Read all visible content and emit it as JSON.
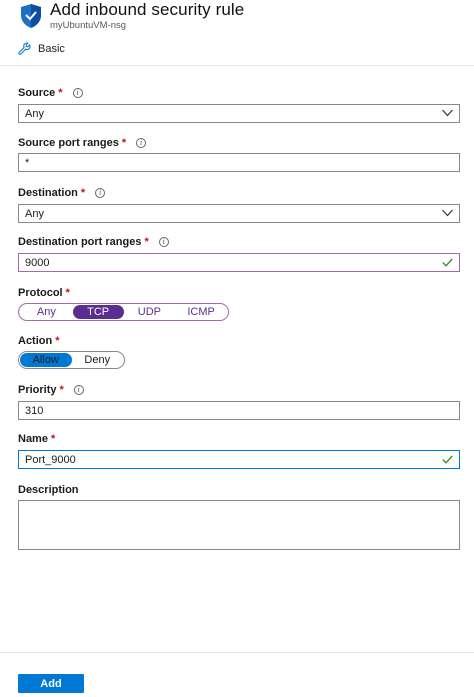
{
  "header": {
    "title": "Add inbound security rule",
    "subtitle": "myUbuntuVM-nsg",
    "mode_label": "Basic"
  },
  "form": {
    "source": {
      "label": "Source",
      "required": "*",
      "value": "Any"
    },
    "source_port_ranges": {
      "label": "Source port ranges",
      "required": "*",
      "value": "*"
    },
    "destination": {
      "label": "Destination",
      "required": "*",
      "value": "Any"
    },
    "destination_port_ranges": {
      "label": "Destination port ranges",
      "required": "*",
      "value": "9000"
    },
    "protocol": {
      "label": "Protocol",
      "required": "*",
      "options": [
        "Any",
        "TCP",
        "UDP",
        "ICMP"
      ],
      "selected": "TCP"
    },
    "action": {
      "label": "Action",
      "required": "*",
      "options": [
        "Allow",
        "Deny"
      ],
      "selected": "Allow"
    },
    "priority": {
      "label": "Priority",
      "required": "*",
      "value": "310"
    },
    "name": {
      "label": "Name",
      "required": "*",
      "value": "Port_9000"
    },
    "description": {
      "label": "Description",
      "value": ""
    }
  },
  "footer": {
    "add_label": "Add"
  },
  "colors": {
    "accent": "#0078d4",
    "protocol_selected": "#5c2d91",
    "valid_check": "#2e8b2e",
    "required": "#c50f1f"
  },
  "icons": {
    "header": "shield-icon",
    "mode": "wrench-icon",
    "info": "info-icon",
    "dropdown": "chevron-down-icon",
    "valid": "checkmark-icon"
  }
}
